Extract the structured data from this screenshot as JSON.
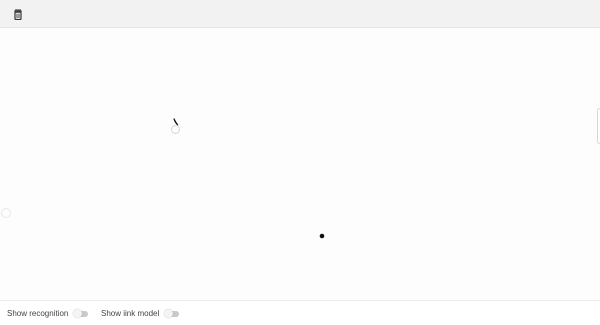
{
  "toolbar": {
    "delete_icon": "trash-icon"
  },
  "footer": {
    "show_recognition_label": "Show recognition",
    "show_recognition_on": false,
    "show_iink_model_label": "Show iink model",
    "show_iink_model_on": false
  },
  "colors": {
    "toolbar_bg": "#f2f2f2",
    "ink": "#111111",
    "switch_off": "#c9c9c9"
  }
}
